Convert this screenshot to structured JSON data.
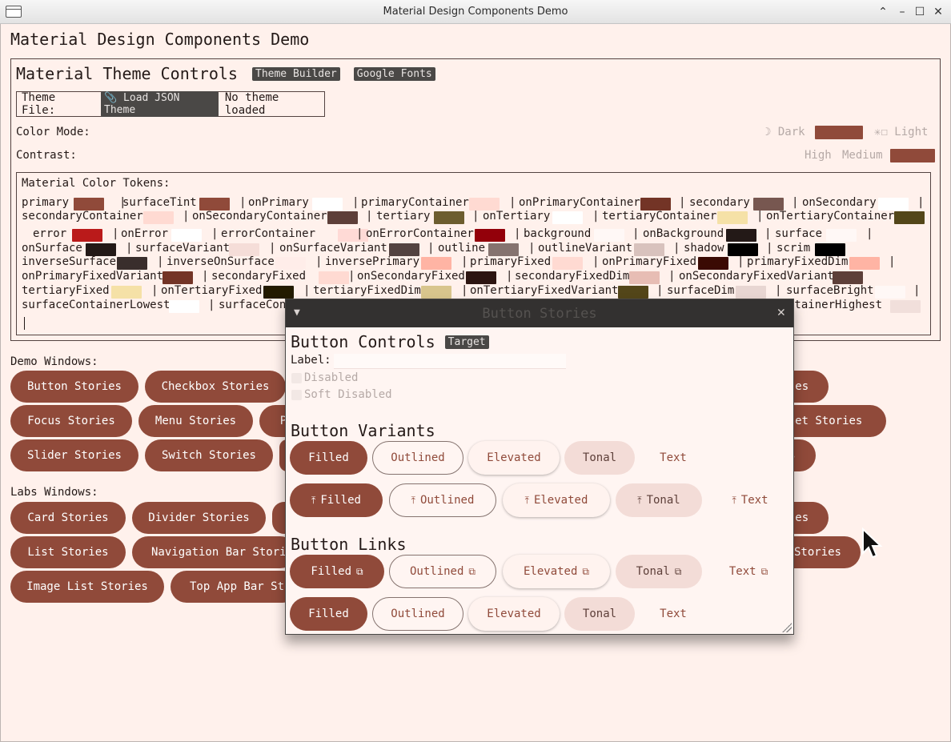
{
  "window": {
    "title": "Material Design Components Demo"
  },
  "app": {
    "heading": "Material Design Components Demo",
    "theme_controls_title": "Material Theme Controls",
    "theme_builder_chip": "Theme Builder",
    "google_fonts_chip": "Google Fonts",
    "theme_file_label": "Theme File:",
    "load_json_button": "📎 Load JSON Theme",
    "theme_status": "No theme loaded",
    "color_mode_label": "Color Mode:",
    "dark_label": "☽ Dark",
    "light_label": "✳☐ Light",
    "contrast_label": "Contrast:",
    "high_label": "High",
    "medium_label": "Medium",
    "tokens_title": "Material Color Tokens:",
    "demo_windows_label": "Demo Windows:",
    "labs_windows_label": "Labs Windows:"
  },
  "colors": {
    "primary": "#904a3a",
    "background": "#fff1ec"
  },
  "tokens": [
    {
      "name": "primary",
      "color": "#904a3a"
    },
    {
      "name": "surfaceTint",
      "color": "#904a3a"
    },
    {
      "name": "onPrimary",
      "color": "#ffffff"
    },
    {
      "name": "primaryContainer",
      "color": "#ffdad2"
    },
    {
      "name": "onPrimaryContainer",
      "color": "#733426"
    },
    {
      "name": "secondary",
      "color": "#775750"
    },
    {
      "name": "onSecondary",
      "color": "#ffffff"
    },
    {
      "name": "secondaryContainer",
      "color": "#ffdad2"
    },
    {
      "name": "onSecondaryContainer",
      "color": "#5d3f39"
    },
    {
      "name": "tertiary",
      "color": "#6c5d2f"
    },
    {
      "name": "onTertiary",
      "color": "#ffffff"
    },
    {
      "name": "tertiaryContainer",
      "color": "#f5e1a7"
    },
    {
      "name": "onTertiaryContainer",
      "color": "#534619"
    },
    {
      "name": "error",
      "color": "#ba1a1a"
    },
    {
      "name": "onError",
      "color": "#ffffff"
    },
    {
      "name": "errorContainer",
      "color": "#ffdad6"
    },
    {
      "name": "onErrorContainer",
      "color": "#93000a"
    },
    {
      "name": "background",
      "color": "#fff8f6"
    },
    {
      "name": "onBackground",
      "color": "#231917"
    },
    {
      "name": "surface",
      "color": "#fff8f6"
    },
    {
      "name": "onSurface",
      "color": "#231917"
    },
    {
      "name": "surfaceVariant",
      "color": "#f5ddd8"
    },
    {
      "name": "onSurfaceVariant",
      "color": "#534341"
    },
    {
      "name": "outline",
      "color": "#85736f"
    },
    {
      "name": "outlineVariant",
      "color": "#d8c2bd"
    },
    {
      "name": "shadow",
      "color": "#000000"
    },
    {
      "name": "scrim",
      "color": "#000000"
    },
    {
      "name": "inverseSurface",
      "color": "#392e2c"
    },
    {
      "name": "inverseOnSurface",
      "color": "#ffede9"
    },
    {
      "name": "inversePrimary",
      "color": "#ffb4a4"
    },
    {
      "name": "primaryFixed",
      "color": "#ffdad2"
    },
    {
      "name": "onPrimaryFixed",
      "color": "#3a0a03"
    },
    {
      "name": "primaryFixedDim",
      "color": "#ffb4a4"
    },
    {
      "name": "onPrimaryFixedVariant",
      "color": "#733426"
    },
    {
      "name": "secondaryFixed",
      "color": "#ffdad2"
    },
    {
      "name": "onSecondaryFixed",
      "color": "#2c1511"
    },
    {
      "name": "secondaryFixedDim",
      "color": "#e7bdb4"
    },
    {
      "name": "onSecondaryFixedVariant",
      "color": "#5d3f39"
    },
    {
      "name": "tertiaryFixed",
      "color": "#f5e1a7"
    },
    {
      "name": "onTertiaryFixed",
      "color": "#231b00"
    },
    {
      "name": "tertiaryFixedDim",
      "color": "#d8c58d"
    },
    {
      "name": "onTertiaryFixedVariant",
      "color": "#534619"
    },
    {
      "name": "surfaceDim",
      "color": "#e8d6d2"
    },
    {
      "name": "surfaceBright",
      "color": "#fff8f6"
    },
    {
      "name": "surfaceContainerLowest",
      "color": "#ffffff"
    },
    {
      "name": "surfaceCont",
      "color": "#fff0ee"
    },
    {
      "name": "ntainerHighest",
      "color": "#f1dfdb"
    }
  ],
  "demo_windows": [
    "Button Stories",
    "Checkbox Stories",
    "les",
    "Focus Stories",
    "Menu Stories",
    "P",
    "Set Stories",
    "Slider Stories",
    "Switch Stories",
    "s"
  ],
  "labs_windows": [
    "Card Stories",
    "Divider Stories",
    "les",
    "List Stories",
    "Navigation Bar Stories",
    "Stories",
    "Image List Stories",
    "Top App Bar Stories"
  ],
  "dialog": {
    "title": "Button Stories",
    "controls_heading": "Button Controls",
    "target_chip": "Target",
    "label_field_label": "Label:",
    "label_value": "",
    "disabled_label": "Disabled",
    "soft_disabled_label": "Soft Disabled",
    "variants_heading": "Button Variants",
    "links_heading": "Button Links",
    "variants": [
      "Filled",
      "Outlined",
      "Elevated",
      "Tonal",
      "Text"
    ],
    "upload_icon": "⤒",
    "link_icon": "⧉"
  }
}
